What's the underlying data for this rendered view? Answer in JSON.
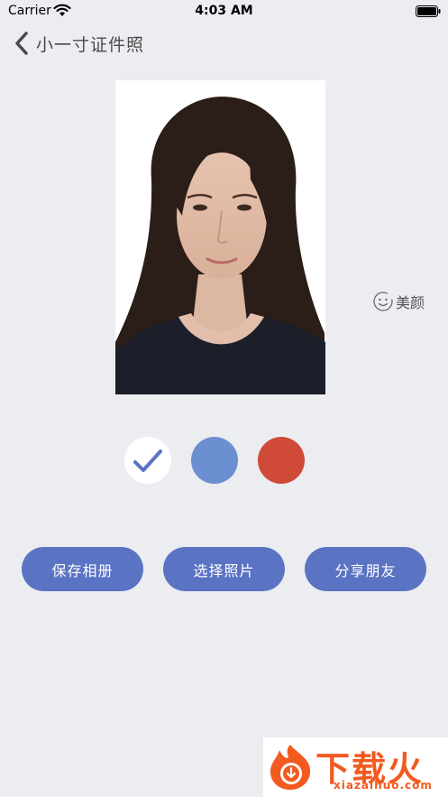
{
  "status_bar": {
    "carrier": "Carrier",
    "time": "4:03 AM",
    "icons": [
      "wifi-icon",
      "battery-icon"
    ]
  },
  "nav": {
    "back_icon": "chevron-left-icon",
    "title": "小一寸证件照"
  },
  "photo": {
    "background_color": "#ffffff"
  },
  "beauty": {
    "icon": "smile-icon",
    "label": "美颜"
  },
  "background_colors": [
    {
      "name": "white",
      "color": "#ffffff",
      "selected": true
    },
    {
      "name": "blue",
      "color": "#6b8fd0",
      "selected": false
    },
    {
      "name": "red",
      "color": "#d04a39",
      "selected": false
    }
  ],
  "actions": {
    "save_label": "保存相册",
    "choose_label": "选择照片",
    "share_label": "分享朋友",
    "button_color": "#5b73c3"
  },
  "watermark": {
    "text_cn": "下载火",
    "text_en": "xiazaihuo.com",
    "brand_color": "#f35a20"
  },
  "colors": {
    "background": "#ecedf1",
    "check": "#5b73c3"
  }
}
